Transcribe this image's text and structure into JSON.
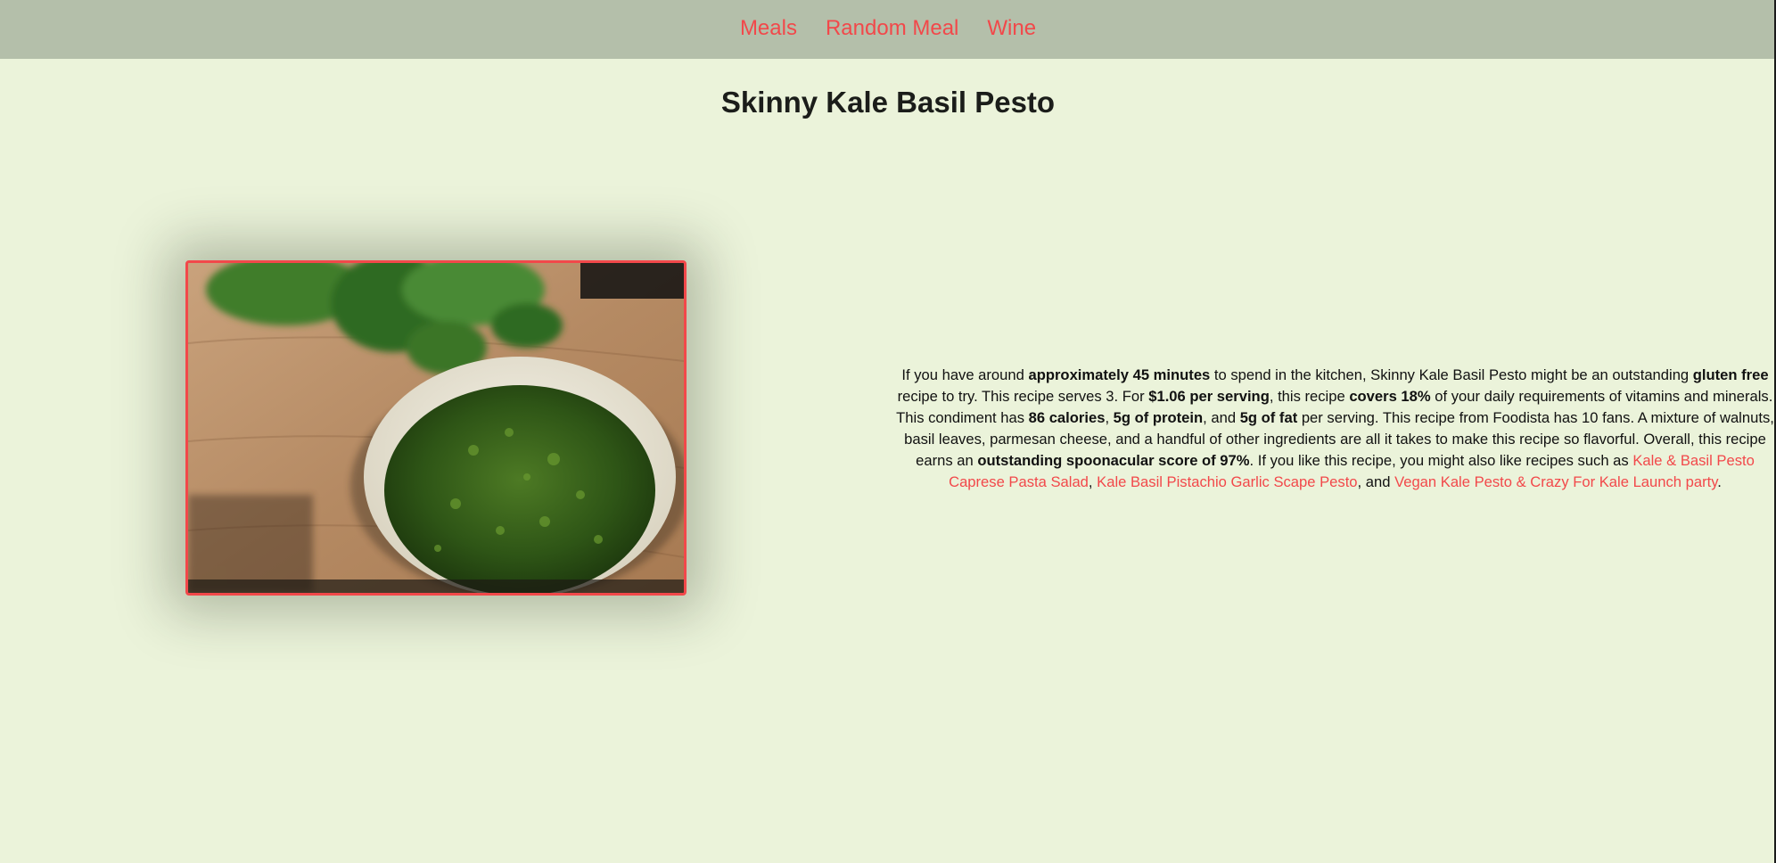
{
  "nav": {
    "items": [
      {
        "label": "Meals"
      },
      {
        "label": "Random Meal"
      },
      {
        "label": "Wine"
      }
    ]
  },
  "recipe": {
    "title": "Skinny Kale Basil Pesto",
    "summary": {
      "t1": "If you have around ",
      "b1": "approximately 45 minutes",
      "t2": " to spend in the kitchen, Skinny Kale Basil Pesto might be an outstanding ",
      "b2": "gluten free",
      "t3": " recipe to try. This recipe serves 3. For ",
      "b3": "$1.06 per serving",
      "t4": ", this recipe ",
      "b4": "covers 18%",
      "t5": " of your daily requirements of vitamins and minerals. This condiment has ",
      "b5": "86 calories",
      "t6": ", ",
      "b6": "5g of protein",
      "t7": ", and ",
      "b7": "5g of fat",
      "t8": " per serving. This recipe from Foodista has 10 fans. A mixture of walnuts, basil leaves, parmesan cheese, and a handful of other ingredients are all it takes to make this recipe so flavorful. Overall, this recipe earns an ",
      "b8": "outstanding spoonacular score of 97%",
      "t9": ". If you like this recipe, you might also like recipes such as ",
      "link1": "Kale & Basil Pesto Caprese Pasta Salad",
      "t10": ", ",
      "link2": "Kale Basil Pistachio Garlic Scape Pesto",
      "t11": ", and ",
      "link3": "Vegan Kale Pesto & Crazy For Kale Launch party",
      "t12": "."
    }
  },
  "colors": {
    "accent": "#f2484a",
    "background": "#ebf3da",
    "navbar": "#b4bfaa"
  },
  "image": {
    "icon": "recipe-photo-pesto-bowl"
  }
}
